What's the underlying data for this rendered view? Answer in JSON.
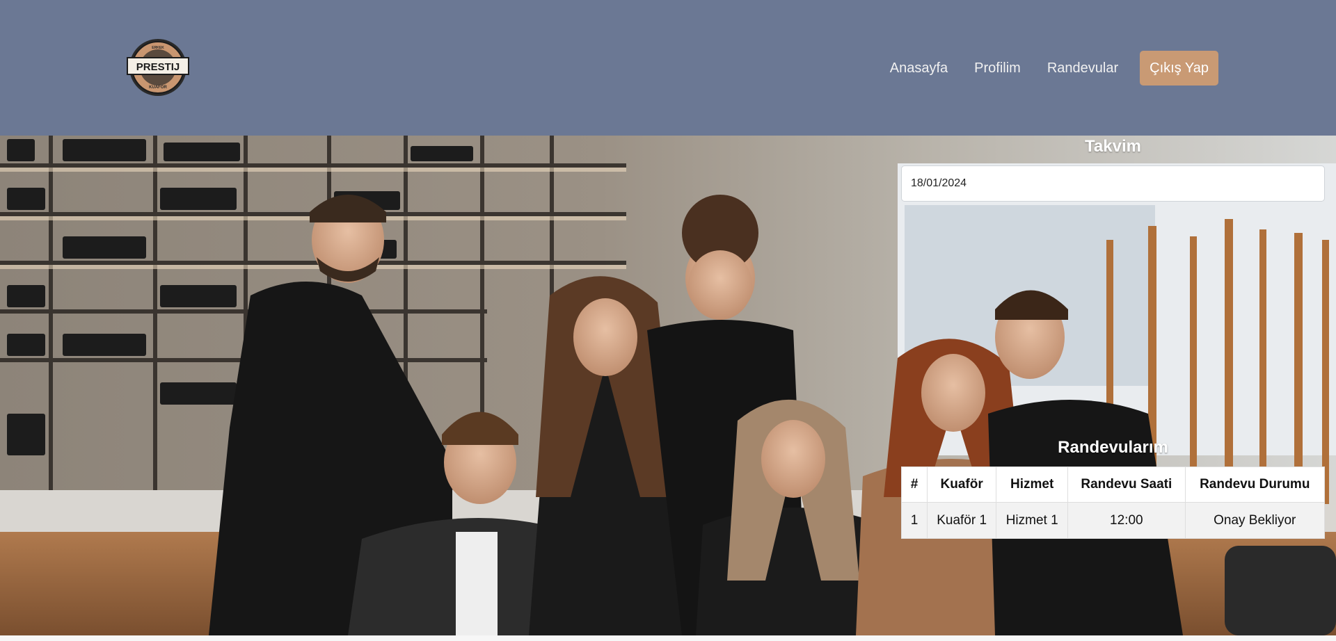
{
  "header": {
    "logo": {
      "top_text": "ERKEK",
      "main_text": "PRESTIJ",
      "bottom_text": "KUAFOR"
    },
    "nav": [
      {
        "label": "Anasayfa"
      },
      {
        "label": "Profilim"
      },
      {
        "label": "Randevular"
      }
    ],
    "logout_label": "Çıkış Yap",
    "colors": {
      "background": "#6b7894",
      "accent": "#c99a74"
    }
  },
  "calendar": {
    "title": "Takvim",
    "date_value": "18/01/2024"
  },
  "appointments": {
    "title": "Randevularım",
    "columns": [
      "#",
      "Kuaför",
      "Hizmet",
      "Randevu Saati",
      "Randevu Durumu"
    ],
    "rows": [
      [
        "1",
        "Kuaför 1",
        "Hizmet 1",
        "12:00",
        "Onay Bekliyor"
      ]
    ]
  }
}
